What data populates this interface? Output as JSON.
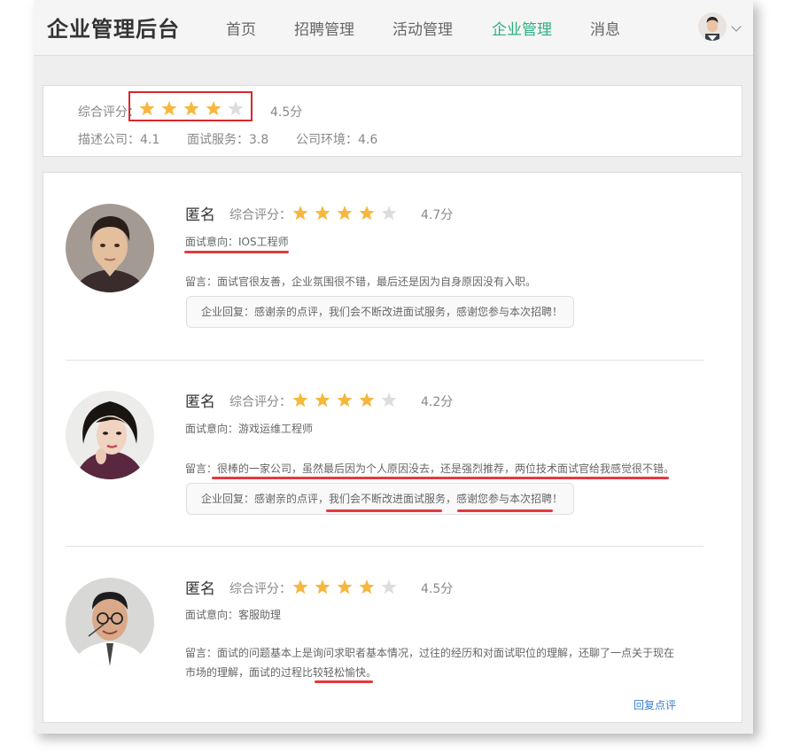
{
  "header": {
    "brand": "企业管理后台",
    "nav": [
      "首页",
      "招聘管理",
      "活动管理",
      "企业管理",
      "消息"
    ],
    "active_nav": "企业管理"
  },
  "summary": {
    "label": "综合评分：",
    "stars": 4,
    "score": "4.5分",
    "describe": "描述公司：4.1",
    "interview_service": "面试服务：3.8",
    "environment": "公司环境：4.6"
  },
  "reviews": [
    {
      "name": "匿名",
      "rating_label": "综合评分：",
      "stars": 4,
      "score": "4.7分",
      "intent": "面试意向：IOS工程师",
      "message": "留言：面试官很友善，企业氛围很不错，最后还是因为自身原因没有入职。",
      "reply": "企业回复：感谢亲的点评，我们会不断改进面试服务，感谢您参与本次招聘！"
    },
    {
      "name": "匿名",
      "rating_label": "综合评分：",
      "stars": 4,
      "score": "4.2分",
      "intent": "面试意向：游戏运维工程师",
      "message": "留言：很棒的一家公司，虽然最后因为个人原因没去，还是强烈推荐，两位技术面试官给我感觉很不错。",
      "reply": "企业回复：感谢亲的点评，我们会不断改进面试服务，感谢您参与本次招聘！"
    },
    {
      "name": "匿名",
      "rating_label": "综合评分：",
      "stars": 4,
      "score": "4.5分",
      "intent": "面试意向：客服助理",
      "message": "留言：面试的问题基本上是询问求职者基本情况，过往的经历和对面试职位的理解，还聊了一点关于现在市场的理解，面试的过程比较轻松愉快。",
      "action": "回复点评"
    }
  ],
  "colors": {
    "accent": "#2bb07f",
    "star_on": "#f6b73c",
    "star_off": "#dddddd",
    "annotation": "#d9262b",
    "link": "#3a7fd1"
  }
}
